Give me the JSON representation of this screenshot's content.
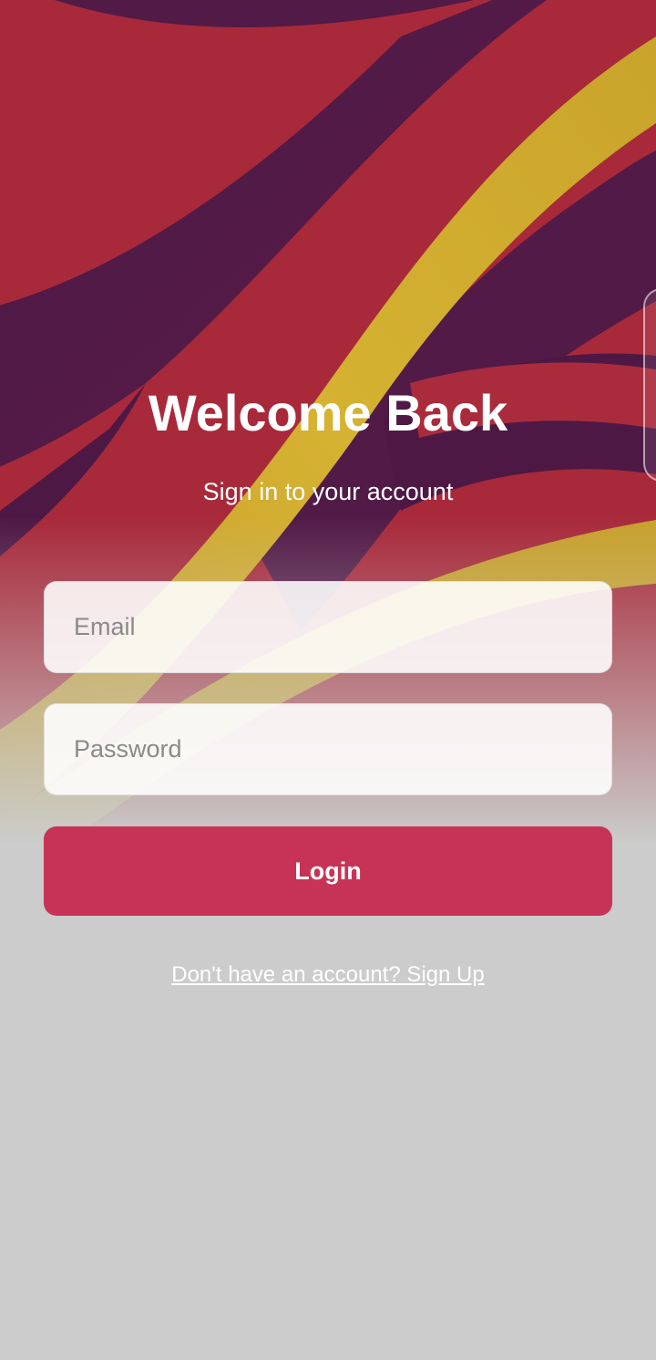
{
  "header": {
    "title": "Welcome Back",
    "subtitle": "Sign in to your account"
  },
  "form": {
    "email_placeholder": "Email",
    "email_value": "",
    "password_placeholder": "Password",
    "password_value": "",
    "login_label": "Login"
  },
  "footer": {
    "signup_text": "Don't have an account? Sign Up"
  },
  "colors": {
    "accent": "#c73356",
    "wave_red": "#a52a3c",
    "wave_purple": "#521a47",
    "wave_gold": "#cba72d",
    "background_gray": "#cbcccb"
  }
}
